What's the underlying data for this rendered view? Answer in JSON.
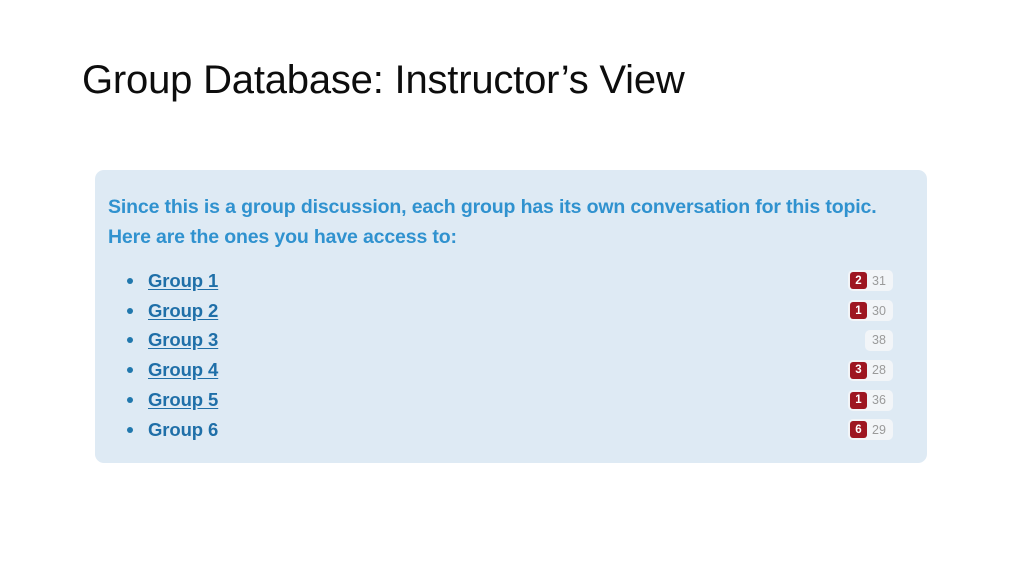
{
  "slide": {
    "title": "Group Database: Instructor’s View",
    "panel": {
      "intro_text": "Since this is a group discussion, each group has its own conversation for this topic. Here are the ones you have access to:",
      "rows": [
        {
          "label": "Group 1",
          "is_link": true,
          "unread": "2",
          "total": "31"
        },
        {
          "label": "Group 2",
          "is_link": true,
          "unread": "1",
          "total": "30"
        },
        {
          "label": "Group 3",
          "is_link": true,
          "unread": "",
          "total": "38"
        },
        {
          "label": "Group 4",
          "is_link": true,
          "unread": "3",
          "total": "28"
        },
        {
          "label": "Group 5",
          "is_link": true,
          "unread": "1",
          "total": "36"
        },
        {
          "label": "Group 6",
          "is_link": false,
          "unread": "6",
          "total": "29"
        }
      ]
    }
  },
  "colors": {
    "panel_background": "#deeaf4",
    "intro_text": "#3092cf",
    "link_text": "#1f6fa8",
    "unread_badge": "#9e1621",
    "total_text": "#9a9a9a",
    "title_text": "#0d0d0d"
  }
}
